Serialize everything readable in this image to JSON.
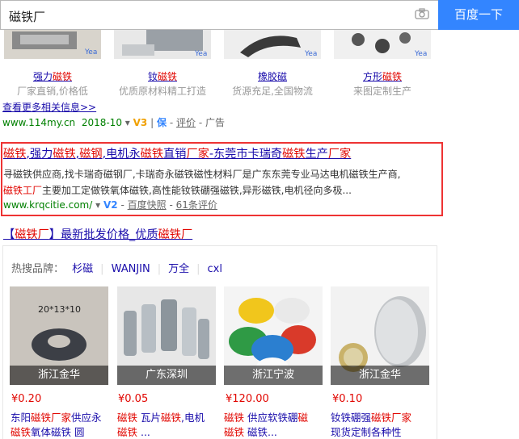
{
  "search": {
    "query": "磁铁厂",
    "button": "百度一下"
  },
  "ad": {
    "thumbs": [
      {
        "label_pre": "强力",
        "label_red": "磁铁",
        "label_post": "",
        "sub": "厂家直销,价格低"
      },
      {
        "label_pre": "钕",
        "label_red": "磁铁",
        "label_post": "",
        "sub": "优质原材料精工打造"
      },
      {
        "label_pre": "",
        "label_red": "",
        "label_post": "橡胶磁",
        "sub": "货源充足,全国物流"
      },
      {
        "label_pre": "方形",
        "label_red": "磁铁",
        "label_post": "",
        "sub": "来图定制生产"
      }
    ],
    "more": "查看更多相关信息>>",
    "url": "www.114my.cn",
    "date": "2018-10",
    "v3": "V3",
    "bao": "保",
    "eval": "评价",
    "ad_tag": "广告"
  },
  "result": {
    "title_parts": [
      "磁铁",
      ",强力",
      "磁铁",
      ",",
      "磁钢",
      ",电机永",
      "磁铁",
      "直销",
      "厂家",
      "-东莞市卡瑞奇",
      "磁铁",
      "生产",
      "厂家"
    ],
    "abstract_line1": "寻磁铁供应商,找卡瑞奇磁钢厂,卡瑞奇永磁铁磁性材料厂是广东东莞专业马达电机磁铁生产商,",
    "abstract_line2_red": "磁铁工厂",
    "abstract_line2_rest": "主要加工定做铁氧体磁铁,高性能钕铁硼强磁铁,异形磁铁,电机径向多极...",
    "url": "www.krqcitie.com/",
    "v2": "V2",
    "snapshot": "百度快照",
    "reviews": "61条评价"
  },
  "second": {
    "title_a": "【",
    "title_red": "磁铁厂",
    "title_b": "】最新批发价格_优质",
    "title_red2": "磁铁厂",
    "hot_label": "热搜品牌：",
    "hot_items": [
      "杉磁",
      "WANJIN",
      "万全",
      "cxl"
    ],
    "products": [
      {
        "caption": "浙江金华",
        "price": "¥0.20",
        "desc1_a": "东阳",
        "desc1_red": "磁铁厂家",
        "desc1_b": "供应永",
        "desc2_red": "磁铁",
        "desc2_b": "氧体磁铁 圆",
        "img_text": "20*13*10"
      },
      {
        "caption": "广东深圳",
        "price": "¥0.05",
        "desc1_a": "",
        "desc1_red": "磁铁",
        "desc1_b": " 瓦片",
        "desc1_red2": "磁铁",
        "desc1_c": ",电机",
        "desc2_red": "磁铁",
        "desc2_b": " ..."
      },
      {
        "caption": "浙江宁波",
        "price": "¥120.00",
        "desc1_a": "",
        "desc1_red": "磁铁",
        "desc1_b": " 供应软铁硼",
        "desc1_red2": "磁",
        "desc1_c": "",
        "desc2_red": "磁铁",
        "desc2_b": " 磁铁..."
      },
      {
        "caption": "浙江金华",
        "price": "¥0.10",
        "desc1_a": "钕铁硼强",
        "desc1_red": "磁铁厂家",
        "desc1_b": "",
        "desc2_red": "",
        "desc2_b": "现货定制各种性"
      }
    ]
  }
}
